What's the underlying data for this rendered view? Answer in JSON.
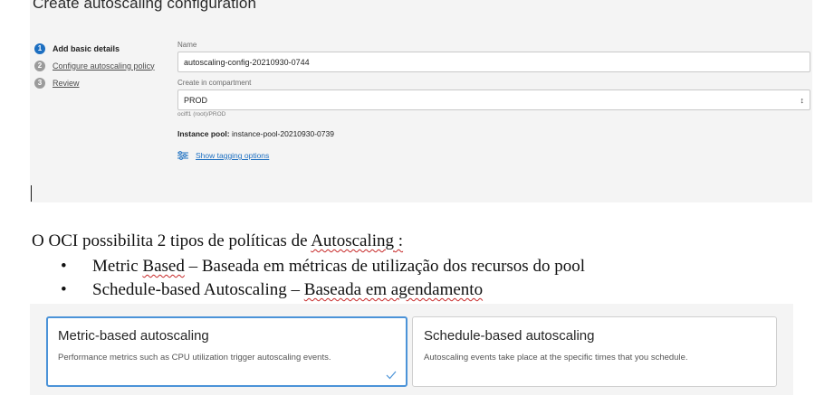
{
  "form": {
    "title": "Create autoscaling configuration",
    "steps": [
      {
        "num": "1",
        "label": "Add basic details"
      },
      {
        "num": "2",
        "label": "Configure autoscaling policy"
      },
      {
        "num": "3",
        "label": "Review"
      }
    ],
    "name_label": "Name",
    "name_value": "autoscaling-config-20210930-0744",
    "compartment_label": "Create in compartment",
    "compartment_value": "PROD",
    "compartment_path": "ociff1 (root)/PROD",
    "pool_label": "Instance pool:",
    "pool_value": "instance-pool-20210930-0739",
    "tagging_link": "Show tagging options",
    "accent_color": "#1d6fc1"
  },
  "document": {
    "intro_prefix": "O OCI possibilita 2 tipos de políticas de ",
    "intro_term": "Autoscaling",
    "intro_suffix": " :",
    "bullets": [
      {
        "lead": "Metric ",
        "term": "Based",
        "rest": " – Baseada em métricas de utilização dos recursos do pool",
        "tail": ""
      },
      {
        "lead": "Schedule-based Autoscaling – ",
        "term": "Baseada em agendamento",
        "rest": "",
        "tail": ""
      }
    ]
  },
  "cards": [
    {
      "title": "Metric-based autoscaling",
      "desc": "Performance metrics such as CPU utilization trigger autoscaling events.",
      "selected": true
    },
    {
      "title": "Schedule-based autoscaling",
      "desc": "Autoscaling events take place at the specific times that you schedule.",
      "selected": false
    }
  ],
  "icons": {
    "step_active_color": "#1d6fc1",
    "check": "checkmark-icon",
    "tag": "sliders-icon",
    "caret": "updown-caret-icon"
  }
}
